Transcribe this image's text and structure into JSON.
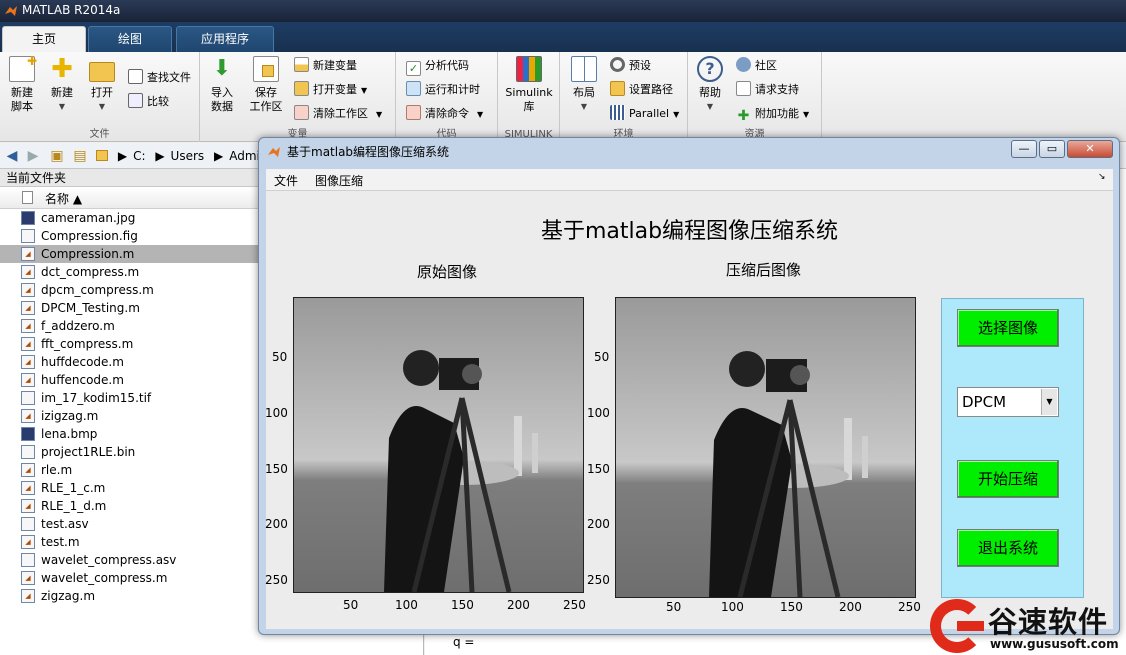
{
  "app": {
    "title": "MATLAB R2014a"
  },
  "ribbon": {
    "tabs": [
      "主页",
      "绘图",
      "应用程序"
    ],
    "file_group": {
      "label": "文件",
      "new_script": "新建\n脚本",
      "new": "新建",
      "open": "打开",
      "find_files": "查找文件",
      "compare": "比较"
    },
    "var_group": {
      "label": "变量",
      "import": "导入\n数据",
      "save": "保存\n工作区",
      "new_var": "新建变量",
      "open_var": "打开变量",
      "clear_ws": "清除工作区"
    },
    "code_group": {
      "label": "代码",
      "analyze": "分析代码",
      "run_time": "运行和计时",
      "clear_cmd": "清除命令"
    },
    "simulink_group": {
      "label": "SIMULINK",
      "simulink": "Simulink\n库"
    },
    "env_group": {
      "label": "环境",
      "layout": "布局",
      "preferences": "预设",
      "set_path": "设置路径",
      "parallel": "Parallel"
    },
    "res_group": {
      "label": "资源",
      "help": "帮助",
      "community": "社区",
      "support": "请求支持",
      "addons": "附加功能"
    }
  },
  "address": {
    "path": [
      "C:",
      "Users",
      "Admin"
    ]
  },
  "folder": {
    "header": "当前文件夹",
    "column": "名称 ▲",
    "files": [
      {
        "name": "cameraman.jpg",
        "type": "img"
      },
      {
        "name": "Compression.fig",
        "type": "fig"
      },
      {
        "name": "Compression.m",
        "type": "m",
        "selected": true
      },
      {
        "name": "dct_compress.m",
        "type": "m"
      },
      {
        "name": "dpcm_compress.m",
        "type": "m"
      },
      {
        "name": "DPCM_Testing.m",
        "type": "m"
      },
      {
        "name": "f_addzero.m",
        "type": "m"
      },
      {
        "name": "fft_compress.m",
        "type": "m"
      },
      {
        "name": "huffdecode.m",
        "type": "m"
      },
      {
        "name": "huffencode.m",
        "type": "m"
      },
      {
        "name": "im_17_kodim15.tif",
        "type": "other"
      },
      {
        "name": "izigzag.m",
        "type": "m"
      },
      {
        "name": "lena.bmp",
        "type": "img"
      },
      {
        "name": "project1RLE.bin",
        "type": "other"
      },
      {
        "name": "rle.m",
        "type": "m"
      },
      {
        "name": "RLE_1_c.m",
        "type": "m"
      },
      {
        "name": "RLE_1_d.m",
        "type": "m"
      },
      {
        "name": "test.asv",
        "type": "other"
      },
      {
        "name": "test.m",
        "type": "m"
      },
      {
        "name": "wavelet_compress.asv",
        "type": "other"
      },
      {
        "name": "wavelet_compress.m",
        "type": "m"
      },
      {
        "name": "zigzag.m",
        "type": "m"
      }
    ]
  },
  "command": {
    "text": "q ="
  },
  "figure": {
    "title": "基于matlab编程图像压缩系统",
    "menus": [
      "文件",
      "图像压缩"
    ],
    "heading": "基于matlab编程图像压缩系统",
    "left_axes_title": "原始图像",
    "right_axes_title": "压缩后图像",
    "y_ticks": [
      "50",
      "100",
      "150",
      "200",
      "250"
    ],
    "x_ticks": [
      "50",
      "100",
      "150",
      "200",
      "250"
    ],
    "buttons": {
      "select": "选择图像",
      "start": "开始压缩",
      "exit": "退出系统"
    },
    "method": {
      "selected": "DPCM"
    }
  },
  "watermark": {
    "text": "谷速软件",
    "url": "www.gususoft.com"
  },
  "colors": {
    "button_green": "#00ef00",
    "panel_cyan": "#aee8fb",
    "ribbon_blue": "#1e3c64"
  }
}
